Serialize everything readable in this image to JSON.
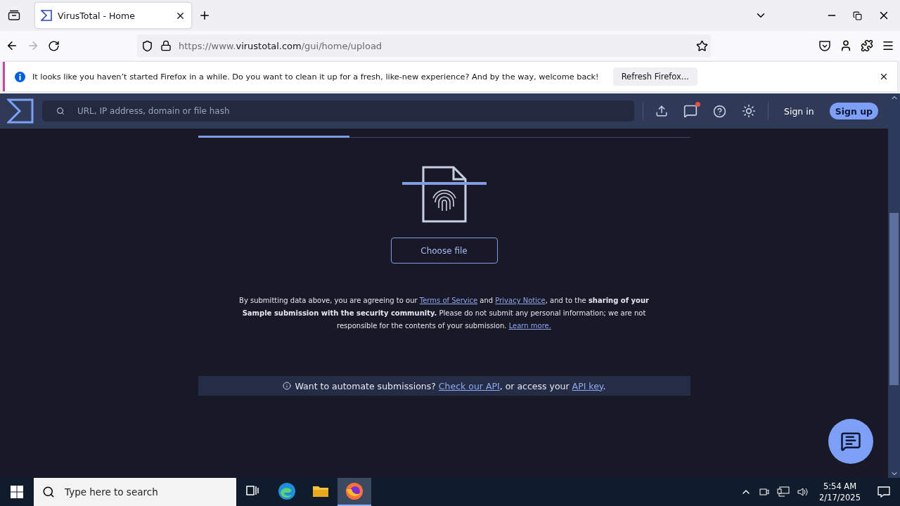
{
  "browser": {
    "tab": {
      "title": "VirusTotal - Home",
      "selected": true
    },
    "url": {
      "prefix": "https://www.",
      "domain": "virustotal.com",
      "path": "/gui/home/upload"
    }
  },
  "notification": {
    "message": "It looks like you haven’t started Firefox in a while. Do you want to clean it up for a fresh, like-new experience? And by the way, welcome back!",
    "button": "Refresh Firefox..."
  },
  "site": {
    "search_placeholder": "URL, IP address, domain or file hash",
    "unread_messages": true,
    "sign_in": "Sign in",
    "sign_up": "Sign up"
  },
  "upload": {
    "choose_button": "Choose file",
    "terms": [
      {
        "kind": "text",
        "text": "By submitting data above, you are agreeing to our "
      },
      {
        "kind": "link",
        "text": "Terms of Service"
      },
      {
        "kind": "text",
        "text": " and "
      },
      {
        "kind": "link",
        "text": "Privacy Notice"
      },
      {
        "kind": "text",
        "text": ", and to the **sharing of your Sample submission with the security community.** Please do not submit any personal information; we are not responsible for the contents of your submission. "
      },
      {
        "kind": "link",
        "text": "Learn more."
      }
    ],
    "api_banner": [
      {
        "kind": "text",
        "text": "Want to automate submissions? "
      },
      {
        "kind": "link",
        "text": "Check our API"
      },
      {
        "kind": "text",
        "text": ", or access your "
      },
      {
        "kind": "link",
        "text": "API key"
      },
      {
        "kind": "text",
        "text": "."
      }
    ]
  },
  "taskbar": {
    "search_placeholder": "Type here to search",
    "apps": [
      {
        "kind": "taskview",
        "selected": false
      },
      {
        "kind": "edge",
        "selected": false
      },
      {
        "kind": "explorer",
        "selected": false
      },
      {
        "kind": "firefox",
        "selected": true
      }
    ],
    "time": "5:54 AM",
    "date": "2/17/2025"
  }
}
